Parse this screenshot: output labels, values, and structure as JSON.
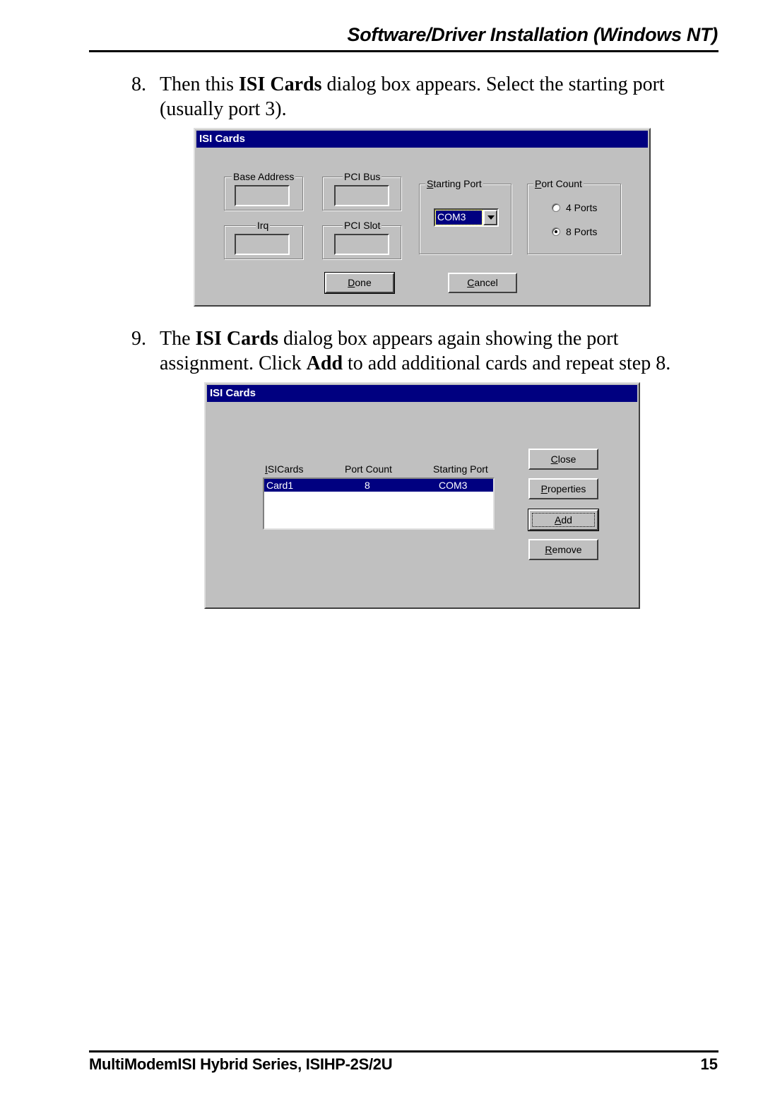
{
  "header": {
    "title": "Software/Driver Installation (Windows NT)"
  },
  "steps": [
    {
      "number": "8.",
      "text_before": "Then this ",
      "bold1": "ISI Cards",
      "text_after": " dialog box appears. Select the starting port (usually port 3)."
    },
    {
      "number": "9.",
      "text_before": "The ",
      "bold1": "ISI Cards",
      "text_mid": " dialog box appears again showing the port assignment. Click ",
      "bold2": "Add",
      "text_after": " to add additional cards and repeat step 8."
    }
  ],
  "dialog1": {
    "title": "ISI Cards",
    "groups": {
      "base_address": {
        "label": "Base Address",
        "value": ""
      },
      "pci_bus": {
        "label": "PCI Bus",
        "value": ""
      },
      "irq": {
        "label": "Irq",
        "value": ""
      },
      "pci_slot": {
        "label": "PCI Slot",
        "value": ""
      }
    },
    "starting_port": {
      "label_accel": "S",
      "label_rest": "tarting Port",
      "selected": "COM3"
    },
    "port_count": {
      "label_accel": "P",
      "label_rest": "ort Count",
      "options": [
        {
          "label": "4 Ports",
          "checked": false
        },
        {
          "label": "8 Ports",
          "checked": true
        }
      ]
    },
    "buttons": {
      "done_accel": "D",
      "done_rest": "one",
      "cancel_accel": "C",
      "cancel_rest": "ancel"
    }
  },
  "dialog2": {
    "title": "ISI Cards",
    "columns": {
      "cards_accel": "I",
      "cards_rest": "SICards",
      "port_count": "Port Count",
      "starting_port": "Starting Port"
    },
    "rows": [
      {
        "card": "Card1",
        "port_count": "8",
        "starting_port": "COM3",
        "selected": true
      }
    ],
    "buttons": {
      "close_accel": "C",
      "close_rest": "lose",
      "properties_accel": "P",
      "properties_rest": "roperties",
      "add_accel": "A",
      "add_rest": "dd",
      "remove_accel": "R",
      "remove_rest": "emove"
    }
  },
  "footer": {
    "left": "MultiModemISI Hybrid Series, ISIHP-2S/2U",
    "page_number": "15"
  },
  "colors": {
    "titlebar": "#000080",
    "dialog_face": "#c0c0c0"
  }
}
